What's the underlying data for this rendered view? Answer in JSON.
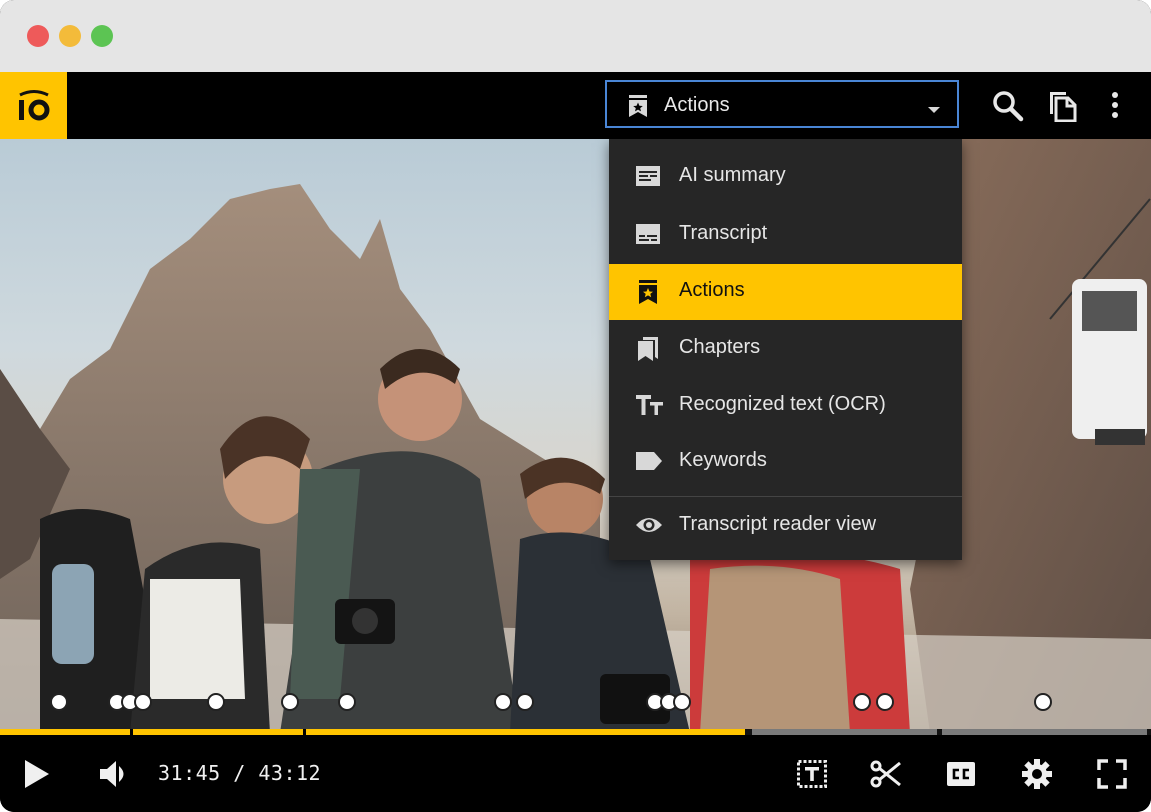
{
  "window": {
    "controls": [
      "close",
      "minimize",
      "maximize"
    ]
  },
  "header": {
    "logo_icon": "brand-logo-icon",
    "select": {
      "value": "Actions",
      "icon": "bookmark-star-icon"
    },
    "buttons": [
      {
        "name": "search",
        "icon": "search-icon"
      },
      {
        "name": "copy",
        "icon": "copy-icon"
      },
      {
        "name": "more",
        "icon": "more-vertical-icon"
      }
    ]
  },
  "menu": {
    "items": [
      {
        "label": "AI summary",
        "icon": "summary-icon",
        "active": false
      },
      {
        "label": "Transcript",
        "icon": "transcript-icon",
        "active": false
      },
      {
        "label": "Actions",
        "icon": "bookmark-star-icon",
        "active": true
      },
      {
        "label": "Chapters",
        "icon": "chapters-icon",
        "active": false
      },
      {
        "label": "Recognized text (OCR)",
        "icon": "text-size-icon",
        "active": false
      },
      {
        "label": "Keywords",
        "icon": "label-icon",
        "active": false
      },
      {
        "label": "Transcript reader view",
        "icon": "eye-icon",
        "active": false
      }
    ]
  },
  "player": {
    "current_time": "31:45",
    "separator": "/",
    "duration": "43:12",
    "progress_fraction": 0.735,
    "accent_color": "#ffc400",
    "controls": [
      {
        "name": "play",
        "icon": "play-icon"
      },
      {
        "name": "volume",
        "icon": "volume-icon"
      },
      {
        "name": "text-track",
        "icon": "text-track-icon"
      },
      {
        "name": "clip",
        "icon": "scissors-icon"
      },
      {
        "name": "captions",
        "icon": "closed-captions-icon"
      },
      {
        "name": "settings",
        "icon": "gear-icon"
      },
      {
        "name": "fullscreen",
        "icon": "fullscreen-icon"
      }
    ]
  }
}
